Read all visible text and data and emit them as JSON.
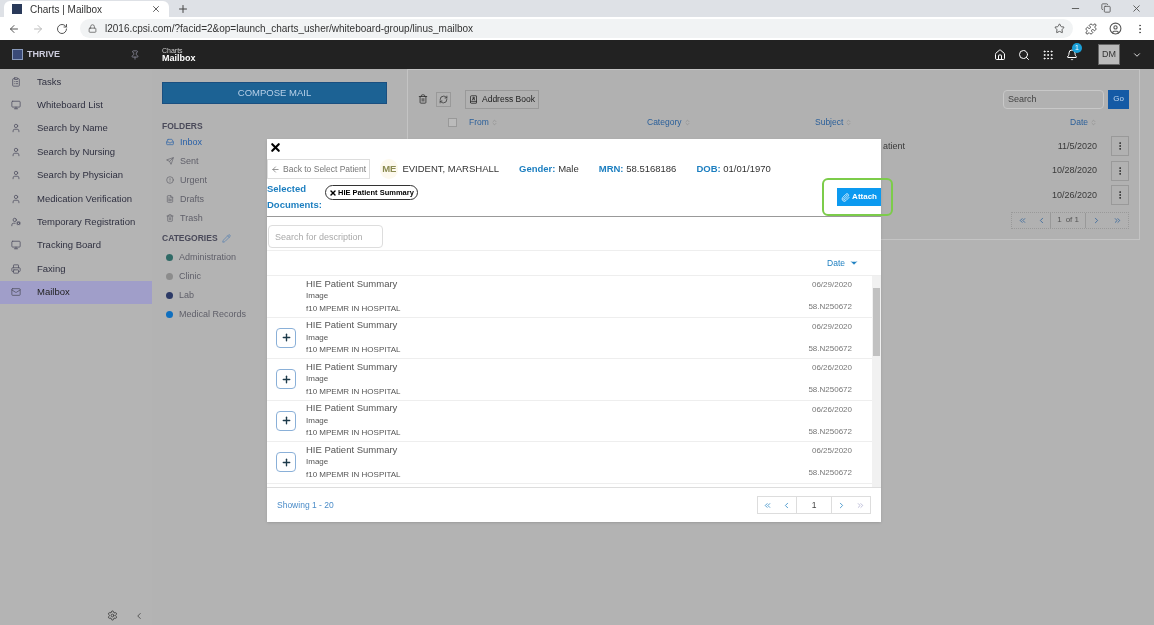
{
  "browser": {
    "tab_title": "Charts | Mailbox",
    "url": "l2016.cpsi.com/?facid=2&op=launch_charts_usher/whiteboard-group/linus_mailbox"
  },
  "header": {
    "brand": "THRIVE",
    "app_small": "Charts",
    "app_title": "Mailbox",
    "notification_count": "1",
    "avatar": "DM"
  },
  "sidebar": {
    "items": [
      {
        "label": "Tasks",
        "selected": false
      },
      {
        "label": "Whiteboard List",
        "selected": false
      },
      {
        "label": "Search by Name",
        "selected": false
      },
      {
        "label": "Search by Nursing",
        "selected": false
      },
      {
        "label": "Search by Physician",
        "selected": false
      },
      {
        "label": "Medication Verification",
        "selected": false
      },
      {
        "label": "Temporary Registration",
        "selected": false
      },
      {
        "label": "Tracking Board",
        "selected": false
      },
      {
        "label": "Faxing",
        "selected": false
      },
      {
        "label": "Mailbox",
        "selected": true
      }
    ]
  },
  "mail_nav": {
    "compose": "COMPOSE MAIL",
    "folders_title": "FOLDERS",
    "folders": [
      {
        "label": "Inbox",
        "selected": true
      },
      {
        "label": "Sent",
        "selected": false
      },
      {
        "label": "Urgent",
        "selected": false
      },
      {
        "label": "Drafts",
        "selected": false
      },
      {
        "label": "Trash",
        "selected": false
      }
    ],
    "categories_title": "CATEGORIES",
    "categories": [
      {
        "label": "Administration",
        "color": "#2f6a66"
      },
      {
        "label": "Clinic",
        "color": "#8c8c8c"
      },
      {
        "label": "Lab",
        "color": "#2c3a66"
      },
      {
        "label": "Medical Records",
        "color": "#0f6fbf"
      }
    ]
  },
  "mail_list": {
    "address_book": "Address Book",
    "search_placeholder": "Search",
    "go": "Go",
    "select_all_checked": false,
    "columns": [
      "From",
      "Category",
      "Subject",
      "Date"
    ],
    "rows": [
      {
        "subject": "atient",
        "date": "11/5/2020"
      },
      {
        "subject": "",
        "date": "10/28/2020"
      },
      {
        "subject": "",
        "date": "10/26/2020"
      }
    ],
    "page": "1",
    "page_of": "of 1"
  },
  "dialog": {
    "back": "Back to Select Patient",
    "initials": "ME",
    "patient": "EVIDENT, MARSHALL",
    "gender_label": "Gender:",
    "gender": "Male",
    "mrn_label": "MRN:",
    "mrn": "58.5168186",
    "dob_label": "DOB:",
    "dob": "01/01/1970",
    "selected_label": "Selected Documents:",
    "selected_docs": [
      "HIE Patient Summary"
    ],
    "attach": "Attach",
    "search_placeholder": "Search for description",
    "sort_label": "Date",
    "documents": [
      {
        "title": "HIE Patient Summary",
        "type": "Image",
        "source": "f10 MPEMR IN HOSPITAL",
        "date": "06/29/2020",
        "account": "58.N250672",
        "added": true
      },
      {
        "title": "HIE Patient Summary",
        "type": "Image",
        "source": "f10 MPEMR IN HOSPITAL",
        "date": "06/29/2020",
        "account": "58.N250672",
        "added": false
      },
      {
        "title": "HIE Patient Summary",
        "type": "Image",
        "source": "f10 MPEMR IN HOSPITAL",
        "date": "06/26/2020",
        "account": "58.N250672",
        "added": false
      },
      {
        "title": "HIE Patient Summary",
        "type": "Image",
        "source": "f10 MPEMR IN HOSPITAL",
        "date": "06/26/2020",
        "account": "58.N250672",
        "added": false
      },
      {
        "title": "HIE Patient Summary",
        "type": "Image",
        "source": "f10 MPEMR IN HOSPITAL",
        "date": "06/25/2020",
        "account": "58.N250672",
        "added": false
      }
    ],
    "showing": "Showing 1 - 20",
    "page": "1"
  }
}
